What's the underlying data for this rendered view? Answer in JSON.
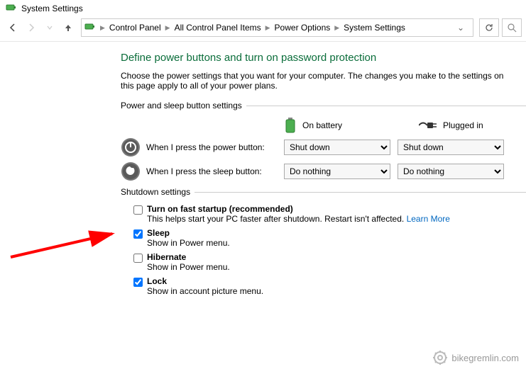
{
  "window": {
    "title": "System Settings"
  },
  "breadcrumb": {
    "items": [
      "Control Panel",
      "All Control Panel Items",
      "Power Options",
      "System Settings"
    ]
  },
  "page": {
    "heading": "Define power buttons and turn on password protection",
    "intro": "Choose the power settings that you want for your computer. The changes you make to the settings on this page apply to all of your power plans."
  },
  "group1": {
    "title": "Power and sleep button settings",
    "col_battery": "On battery",
    "col_plugged": "Plugged in",
    "row_power_label": "When I press the power button:",
    "row_power_battery": "Shut down",
    "row_power_plugged": "Shut down",
    "row_sleep_label": "When I press the sleep button:",
    "row_sleep_battery": "Do nothing",
    "row_sleep_plugged": "Do nothing"
  },
  "group2": {
    "title": "Shutdown settings",
    "fast": {
      "label": "Turn on fast startup (recommended)",
      "desc": "This helps start your PC faster after shutdown. Restart isn't affected.",
      "link": "Learn More",
      "checked": false
    },
    "sleep": {
      "label": "Sleep",
      "desc": "Show in Power menu.",
      "checked": true
    },
    "hibernate": {
      "label": "Hibernate",
      "desc": "Show in Power menu.",
      "checked": false
    },
    "lock": {
      "label": "Lock",
      "desc": "Show in account picture menu.",
      "checked": true
    }
  },
  "watermark": "bikegremlin.com"
}
